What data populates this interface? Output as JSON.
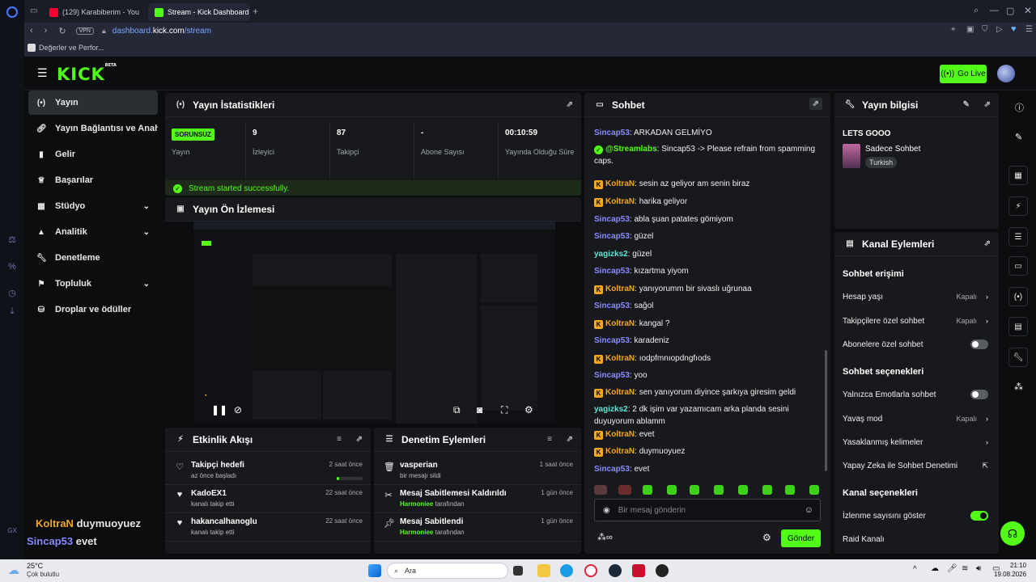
{
  "browser": {
    "tabs": [
      {
        "label": "(129) Karabiberim - You"
      },
      {
        "label": "Stream - Kick Dashboard"
      }
    ],
    "vpn_label": "VPN",
    "url_host": "dashboard.",
    "url_domain": "kick.com",
    "url_path": "/stream",
    "bookmark": "Değerler ve Perfor..."
  },
  "header": {
    "logo": "KICK",
    "logo_badge": "BETA",
    "go_live": "Go Live"
  },
  "nav": {
    "items": [
      {
        "label": "Yayın"
      },
      {
        "label": "Yayın Bağlantısı ve Anahtar"
      },
      {
        "label": "Gelir"
      },
      {
        "label": "Başarılar"
      },
      {
        "label": "Stüdyo"
      },
      {
        "label": "Analitik"
      },
      {
        "label": "Denetleme"
      },
      {
        "label": "Topluluk"
      },
      {
        "label": "Droplar ve ödüller"
      }
    ]
  },
  "overlay_chat": [
    {
      "user": "KoltraN",
      "text": "duymuoyuez",
      "color": "#f5a623"
    },
    {
      "user": "Sincap53",
      "text": "evet",
      "color": "#8b8bff"
    }
  ],
  "stats": {
    "title": "Yayın İstatistikleri",
    "status_badge": "SORUNSUZ",
    "status_label": "Yayın",
    "viewers": "9",
    "viewers_label": "İzleyici",
    "followers": "87",
    "followers_label": "Takipçi",
    "subs": "-",
    "subs_label": "Abone Sayısı",
    "uptime": "00:10:59",
    "uptime_label": "Yayında Olduğu Süre",
    "success_msg": "Stream started successfully."
  },
  "preview": {
    "title": "Yayın Ön İzlemesi"
  },
  "activity": {
    "title": "Etkinlik Akışı",
    "items": [
      {
        "title": "Takipçi hedefi",
        "sub": "az önce başladı",
        "time": "2 saat önce"
      },
      {
        "title": "KadoEX1",
        "sub": "kanalı takip etti",
        "time": "22 saat önce"
      },
      {
        "title": "hakancalhanoglu",
        "sub": "kanalı takip etti",
        "time": "22 saat önce"
      }
    ]
  },
  "moderation": {
    "title": "Denetim Eylemleri",
    "items": [
      {
        "title": "vasperian",
        "sub_user": "",
        "sub": "bir mesajı sildi",
        "time": "1 saat önce"
      },
      {
        "title": "Mesaj Sabitlemesi Kaldırıldı",
        "sub_user": "Harmoniee",
        "sub": "tarafından",
        "time": "1 gün önce"
      },
      {
        "title": "Mesaj Sabitlendi",
        "sub_user": "Harmoniee",
        "sub": "tarafından",
        "time": "1 gün önce"
      }
    ]
  },
  "chat": {
    "title": "Sohbet",
    "placeholder": "Bir mesaj gönderin",
    "send": "Gönder",
    "messages": [
      {
        "user": "Sincap53",
        "color": "#8b8bff",
        "badge": "",
        "text": "ARKADAN GELMİYO"
      },
      {
        "user": "@Streamlabs",
        "color": "#53fc18",
        "badge": "verified",
        "text": "Sincap53 -> Please refrain from spamming caps."
      },
      {
        "user": "KoltraN",
        "color": "#f5a623",
        "badge": "K",
        "text": "sesin az geliyor am senin biraz"
      },
      {
        "user": "KoltraN",
        "color": "#f5a623",
        "badge": "K",
        "text": "harika geliyor"
      },
      {
        "user": "Sincap53",
        "color": "#8b8bff",
        "badge": "",
        "text": "abla şuan patates gömiyom"
      },
      {
        "user": "Sincap53",
        "color": "#8b8bff",
        "badge": "",
        "text": "güzel"
      },
      {
        "user": "yagizks2",
        "color": "#5fe3d6",
        "badge": "",
        "text": "güzel"
      },
      {
        "user": "Sincap53",
        "color": "#8b8bff",
        "badge": "",
        "text": "kızartma yiyom"
      },
      {
        "user": "KoltraN",
        "color": "#f5a623",
        "badge": "K",
        "text": "yanıyorumm bir sivaslı uğrunaa"
      },
      {
        "user": "Sincap53",
        "color": "#8b8bff",
        "badge": "",
        "text": "sağol"
      },
      {
        "user": "KoltraN",
        "color": "#f5a623",
        "badge": "K",
        "text": "kangal ?"
      },
      {
        "user": "Sincap53",
        "color": "#8b8bff",
        "badge": "",
        "text": "karadeniz"
      },
      {
        "user": "KoltraN",
        "color": "#f5a623",
        "badge": "K",
        "text": "ıodpfmnıopdngfıods"
      },
      {
        "user": "Sincap53",
        "color": "#8b8bff",
        "badge": "",
        "text": "yoo"
      },
      {
        "user": "KoltraN",
        "color": "#f5a623",
        "badge": "K",
        "text": "sen yanıyorum diyince şarkıya giresim geldi"
      },
      {
        "user": "yagizks2",
        "color": "#5fe3d6",
        "badge": "",
        "text": "2 dk işim var yazamıcam arka planda sesini duyuyorum ablamm"
      },
      {
        "user": "KoltraN",
        "color": "#f5a623",
        "badge": "K",
        "text": "evet"
      },
      {
        "user": "KoltraN",
        "color": "#f5a623",
        "badge": "K",
        "text": "duymuoyuez"
      },
      {
        "user": "Sincap53",
        "color": "#8b8bff",
        "badge": "",
        "text": "evet"
      }
    ]
  },
  "stream_info": {
    "title": "Yayın bilgisi",
    "stream_title": "LETS GOOO",
    "category": "Sadece Sohbet",
    "language": "Turkish"
  },
  "channel_actions": {
    "title": "Kanal Eylemleri",
    "chat_access": "Sohbet erişimi",
    "account_age": "Hesap yaşı",
    "account_age_value": "Kapalı",
    "followers_only": "Takipçilere özel sohbet",
    "followers_only_value": "Kapalı",
    "subs_only": "Abonelere özel sohbet",
    "chat_options": "Sohbet seçenekleri",
    "emotes_only": "Yalnızca Emotlarla sohbet",
    "slow_mode": "Yavaş mod",
    "slow_mode_value": "Kapalı",
    "banned_words": "Yasaklanmış kelimeler",
    "ai_moderation": "Yapay Zeka ile Sohbet Denetimi",
    "channel_options": "Kanal seçenekleri",
    "show_viewers": "İzlenme sayısını göster",
    "raid": "Raid Kanalı"
  },
  "taskbar": {
    "weather_temp": "25°C",
    "weather_desc": "Çok bulutlu",
    "search": "Ara",
    "time": "21:10",
    "date": "19.08.2026"
  },
  "colors": {
    "accent": "#53fc18",
    "panel": "#17191c",
    "bg": "#0b0d0f"
  }
}
